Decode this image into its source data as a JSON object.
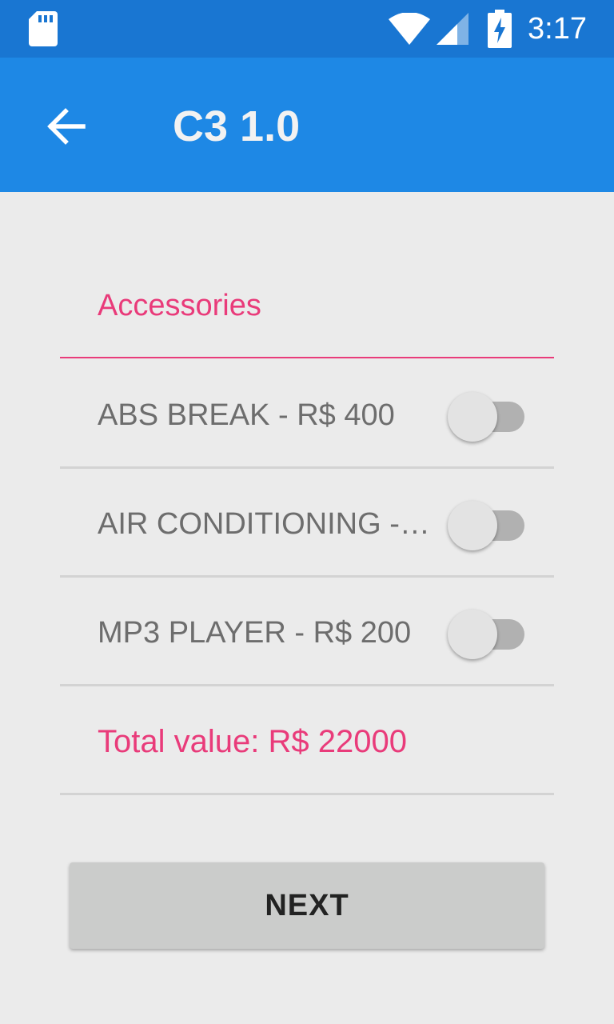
{
  "status_bar": {
    "time": "3:17",
    "icons": [
      "sd-card-icon",
      "wifi-icon",
      "signal-icon",
      "battery-charging-icon"
    ]
  },
  "app_bar": {
    "title": "C3 1.0",
    "back_icon": "arrow-back-icon"
  },
  "accessories": {
    "title": "Accessories",
    "items": [
      {
        "label": "ABS BREAK - R$ 400",
        "checked": false
      },
      {
        "label": "AIR CONDITIONING -…",
        "checked": false
      },
      {
        "label": "MP3 PLAYER - R$ 200",
        "checked": false
      }
    ]
  },
  "total": {
    "label": "Total value: R$ 22000"
  },
  "next_button": {
    "label": "NEXT"
  },
  "colors": {
    "status_bar": "#1976d2",
    "app_bar": "#1e88e5",
    "accent": "#e93b7a",
    "background": "#ebebeb",
    "button": "#cbcccb"
  }
}
